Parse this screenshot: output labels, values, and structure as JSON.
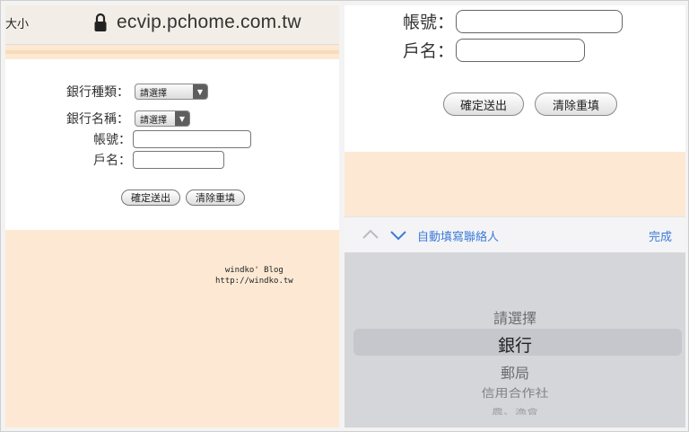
{
  "left_panel": {
    "address_bar": {
      "size_label": "大小",
      "url": "ecvip.pchome.com.tw"
    },
    "form": {
      "bank_type_label": "銀行種類：",
      "bank_type_value": "請選擇",
      "bank_name_label": "銀行名稱：",
      "bank_name_value": "請選擇",
      "account_label": "帳號：",
      "account_name_label": "戶名：",
      "submit_label": "確定送出",
      "reset_label": "清除重填"
    },
    "watermark": {
      "line1": "windko' Blog",
      "line2": "http://windko.tw"
    }
  },
  "right_panel": {
    "form": {
      "account_label": "帳號：",
      "account_name_label": "戶名：",
      "submit_label": "確定送出",
      "reset_label": "清除重填"
    },
    "toolbar": {
      "autofill_label": "自動填寫聯絡人",
      "done_label": "完成"
    },
    "picker": {
      "options": [
        "請選擇",
        "銀行",
        "郵局",
        "信用合作社",
        "農、漁會"
      ],
      "selected": "銀行"
    }
  },
  "colors": {
    "peach": "#fde9d3",
    "link_blue": "#3d7bd7",
    "picker_bg": "#d5d6da"
  }
}
